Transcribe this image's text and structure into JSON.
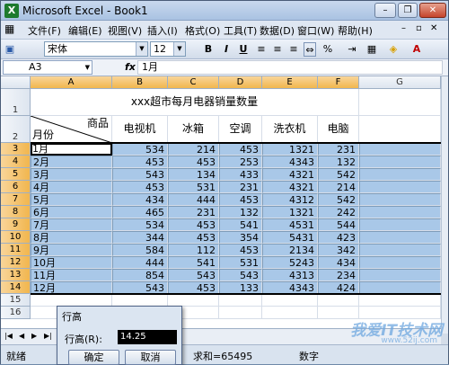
{
  "window": {
    "title": "Microsoft Excel - Book1",
    "app_icon": "X",
    "minimize": "–",
    "restore": "❐",
    "close": "✕"
  },
  "menu": [
    "文件(F)",
    "编辑(E)",
    "视图(V)",
    "插入(I)",
    "格式(O)",
    "工具(T)",
    "数据(D)",
    "窗口(W)",
    "帮助(H)"
  ],
  "help_box": "",
  "toolbar": {
    "font": "宋体",
    "size": "12",
    "bold": "B",
    "italic": "I",
    "underline": "U",
    "percent": "%"
  },
  "formula_bar": {
    "name_box": "A3",
    "fx": "fx",
    "value": "1月"
  },
  "columns": [
    "A",
    "B",
    "C",
    "D",
    "E",
    "F",
    "G"
  ],
  "rows": [
    "1",
    "2",
    "3",
    "4",
    "5",
    "6",
    "7",
    "8",
    "9",
    "10",
    "11",
    "12",
    "13",
    "14",
    "15",
    "16"
  ],
  "sheet": {
    "title": "xxx超市每月电器销量数量",
    "corner_top": "商品",
    "corner_bottom": "月份",
    "products": [
      "电视机",
      "冰箱",
      "空调",
      "洗衣机",
      "电脑"
    ],
    "data": [
      [
        "1月",
        534,
        214,
        453,
        1321,
        231
      ],
      [
        "2月",
        453,
        453,
        253,
        4343,
        132
      ],
      [
        "3月",
        543,
        134,
        433,
        4321,
        542
      ],
      [
        "4月",
        453,
        531,
        231,
        4321,
        214
      ],
      [
        "5月",
        434,
        444,
        453,
        4312,
        542
      ],
      [
        "6月",
        465,
        231,
        132,
        1321,
        242
      ],
      [
        "7月",
        534,
        453,
        541,
        4531,
        544
      ],
      [
        "8月",
        344,
        453,
        354,
        5431,
        423
      ],
      [
        "9月",
        584,
        112,
        453,
        2134,
        342
      ],
      [
        "10月",
        444,
        541,
        531,
        5243,
        434
      ],
      [
        "11月",
        854,
        543,
        543,
        4313,
        234
      ],
      [
        "12月",
        543,
        453,
        133,
        4343,
        424
      ]
    ]
  },
  "status": {
    "ready": "就绪",
    "sum": "求和=65495",
    "mode": "数字"
  },
  "dialog": {
    "title": "行高",
    "label": "行高(R):",
    "value": "14.25",
    "ok": "确定",
    "cancel": "取消"
  },
  "watermark": {
    "main": "我爱IT技术网",
    "sub": "www.52ij.com"
  },
  "colors": {
    "selection": "#a9c8e8",
    "header_highlight": "#f1b64e"
  }
}
